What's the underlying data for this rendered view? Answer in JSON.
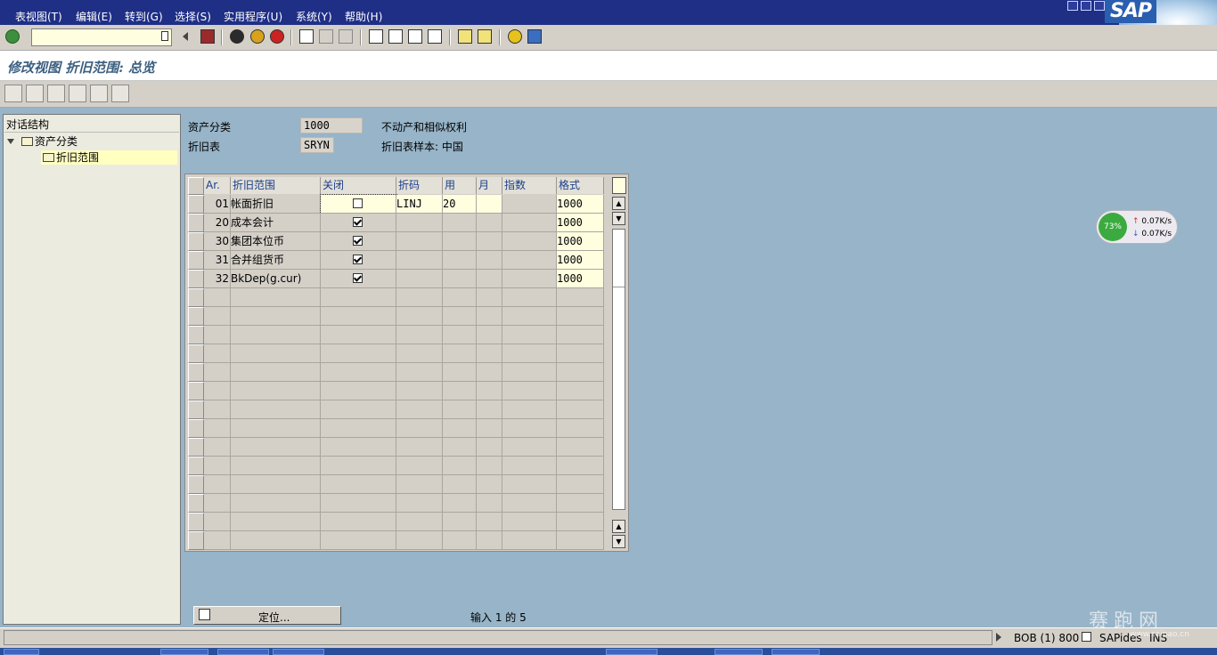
{
  "menu": {
    "items": [
      "表视图(T)",
      "编辑(E)",
      "转到(G)",
      "选择(S)",
      "实用程序(U)",
      "系统(Y)",
      "帮助(H)"
    ],
    "logo": "SAP"
  },
  "toolbar": {
    "command_value": ""
  },
  "title": "修改视图 折旧范围: 总览",
  "tree": {
    "header": "对话结构",
    "items": [
      "资产分类",
      "折旧范围"
    ]
  },
  "header_fields": {
    "asset_class_label": "资产分类",
    "asset_class_value": "1000",
    "asset_class_desc": "不动产和相似权利",
    "dep_key_label": "折旧表",
    "dep_key_value": "SRYN",
    "dep_key_desc": "折旧表样本: 中国"
  },
  "table": {
    "columns": [
      "Ar.",
      "折旧范围",
      "关闭",
      "折码",
      "用",
      "月",
      "指数",
      "格式"
    ],
    "rows": [
      {
        "ar": "01",
        "name": "帐面折旧",
        "closed": false,
        "key": "LINJ",
        "use": "20",
        "month": "",
        "index": "",
        "layout": "1000"
      },
      {
        "ar": "20",
        "name": "成本会计",
        "closed": true,
        "key": "",
        "use": "",
        "month": "",
        "index": "",
        "layout": "1000"
      },
      {
        "ar": "30",
        "name": "集团本位币",
        "closed": true,
        "key": "",
        "use": "",
        "month": "",
        "index": "",
        "layout": "1000"
      },
      {
        "ar": "31",
        "name": "合并组货币",
        "closed": true,
        "key": "",
        "use": "",
        "month": "",
        "index": "",
        "layout": "1000"
      },
      {
        "ar": "32",
        "name": "BkDep(g.cur)",
        "closed": true,
        "key": "",
        "use": "",
        "month": "",
        "index": "",
        "layout": "1000"
      }
    ]
  },
  "bottom": {
    "position_button": "定位...",
    "entry_info": "输入 1 的 5"
  },
  "statusbar": {
    "system": "BOB (1) 800",
    "server": "SAPides",
    "mode": "INS"
  },
  "network": {
    "percent": "73%",
    "up": "0.07K/s",
    "down": "0.07K/s"
  },
  "watermark": {
    "text": "赛跑网",
    "url": "www.saipao.cn"
  }
}
